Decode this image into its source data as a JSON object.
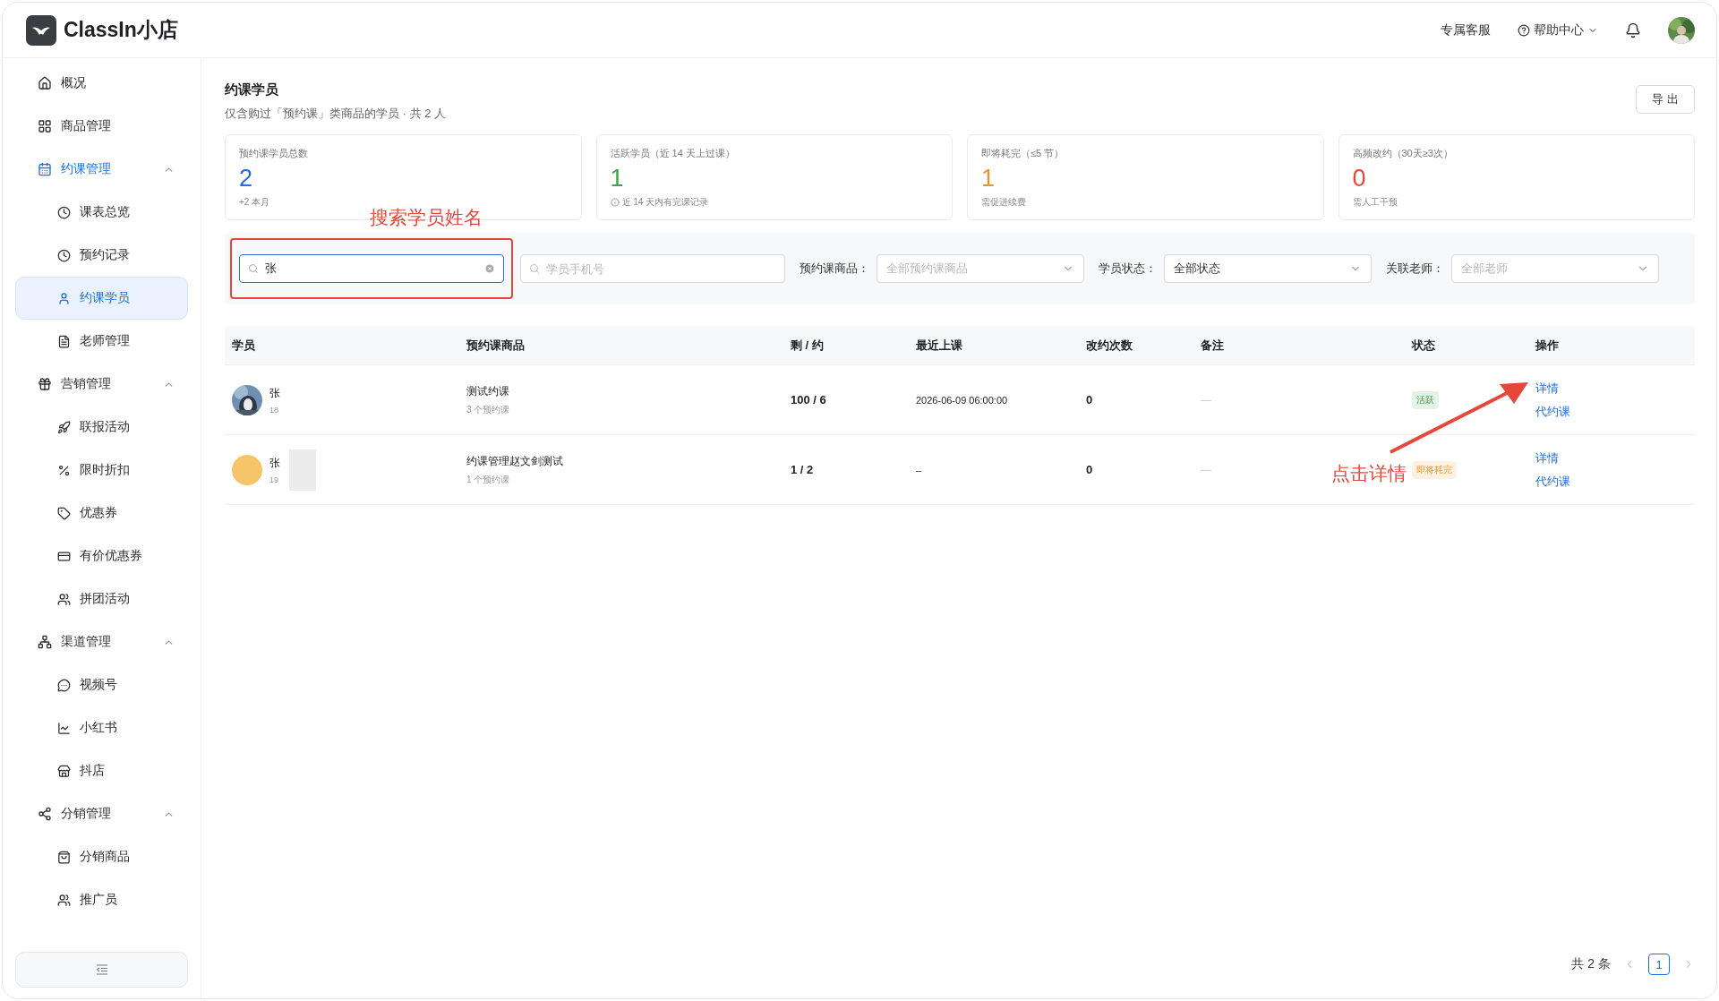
{
  "header": {
    "logo_text": "ClassIn小店",
    "links": [
      "专属客服"
    ],
    "help": "帮助中心"
  },
  "sidebar": {
    "items": [
      {
        "label": "概况",
        "selected": false
      },
      {
        "label": "商品管理",
        "selected": false
      },
      {
        "label": "约课管理",
        "selected": false,
        "expanded": true,
        "children": [
          {
            "label": "课表总览",
            "selected": false
          },
          {
            "label": "预约记录",
            "selected": false
          },
          {
            "label": "约课学员",
            "selected": true
          },
          {
            "label": "老师管理",
            "selected": false
          }
        ]
      },
      {
        "label": "营销管理",
        "selected": false,
        "expanded": true,
        "children": [
          {
            "label": "联报活动",
            "selected": false
          },
          {
            "label": "限时折扣",
            "selected": false
          },
          {
            "label": "优惠券",
            "selected": false
          },
          {
            "label": "有价优惠券",
            "selected": false
          },
          {
            "label": "拼团活动",
            "selected": false
          }
        ]
      },
      {
        "label": "渠道管理",
        "selected": false,
        "expanded": true,
        "children": [
          {
            "label": "视频号",
            "selected": false
          },
          {
            "label": "小红书",
            "selected": false
          },
          {
            "label": "抖店",
            "selected": false
          }
        ]
      },
      {
        "label": "分销管理",
        "selected": false,
        "expanded": true,
        "children": [
          {
            "label": "分销商品",
            "selected": false
          },
          {
            "label": "推广员",
            "selected": false
          }
        ]
      }
    ]
  },
  "page": {
    "title": "约课学员",
    "subtitle": "仅含购过「预约课」类商品的学员 · 共 2 人",
    "export_button": "导 出"
  },
  "stats": [
    {
      "label": "预约课学员总数",
      "value": "2",
      "note": "+2 本月",
      "color": "#1f6fe0",
      "info": false
    },
    {
      "label": "活跃学员（近 14 天上过课）",
      "value": "1",
      "note": "近 14 天内有完课记录",
      "color": "#3aa34a",
      "info": true
    },
    {
      "label": "即将耗完（≤5 节）",
      "value": "1",
      "note": "需促进续费",
      "color": "#f0932b",
      "info": false
    },
    {
      "label": "高频改约（30天≥3次）",
      "value": "0",
      "note": "需人工干预",
      "color": "#e5483b",
      "info": false
    }
  ],
  "filters": {
    "name_search": {
      "value": "张"
    },
    "phone_search": {
      "placeholder": "学员手机号"
    },
    "selects": [
      {
        "label": "预约课商品：",
        "placeholder": "全部预约课商品"
      },
      {
        "label": "学员状态：",
        "value": "全部状态"
      },
      {
        "label": "关联老师：",
        "placeholder": "全部老师"
      }
    ]
  },
  "table": {
    "columns": [
      "学员",
      "预约课商品",
      "剩 / 约",
      "最近上课",
      "改约次数",
      "备注",
      "状态",
      "操作"
    ],
    "rows": [
      {
        "name": "张",
        "phone": "18",
        "avatar": {
          "kind": "picture"
        },
        "product": "测试约课",
        "product_note": "3 个预约课",
        "remaining": "100 / 6",
        "last_class": "2026-06-09 06:00:00",
        "changes": "0",
        "remark": "—",
        "status": {
          "text": "活跃",
          "kind": "active"
        },
        "actions": [
          "详情",
          "代约课"
        ]
      },
      {
        "name": "张",
        "phone": "19",
        "avatar": {
          "kind": "circle"
        },
        "product": "约课管理赵文剑测试",
        "product_note": "1 个预约课",
        "remaining": "1 / 2",
        "last_class": "–",
        "changes": "0",
        "remark": "—",
        "status": {
          "text": "即将耗完",
          "kind": "low"
        },
        "actions": [
          "详情",
          "代约课"
        ]
      }
    ]
  },
  "pagination": {
    "total": "共 2 条",
    "pages": [
      {
        "label": "1",
        "selected": true
      }
    ]
  },
  "annotations": {
    "search_label": "搜索学员姓名",
    "detail_label": "点击详情"
  }
}
